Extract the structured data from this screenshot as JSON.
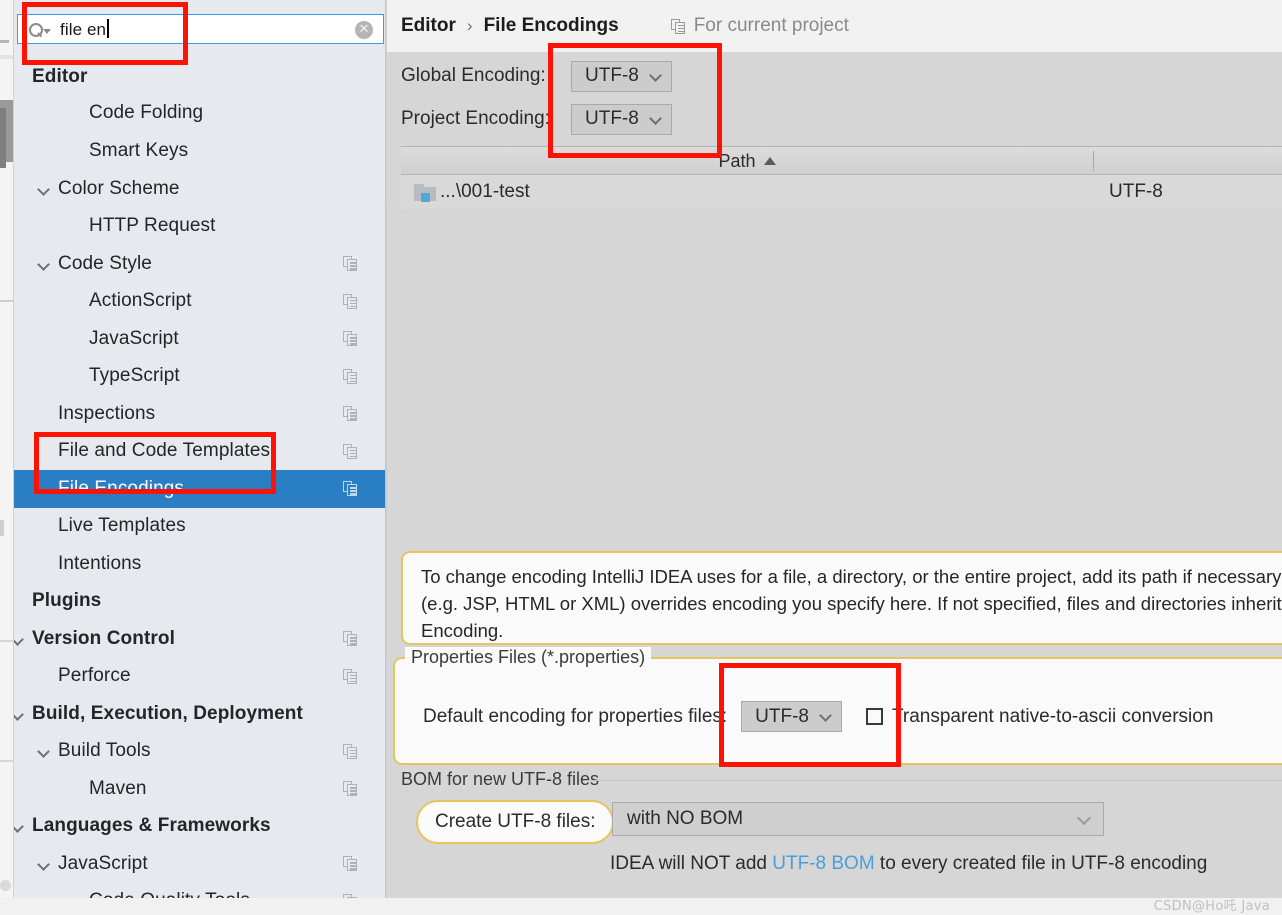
{
  "search": {
    "value": "file en",
    "icon": "search-icon",
    "clear_icon": "clear-circle-icon"
  },
  "sidebar": {
    "items": [
      {
        "label": "Editor",
        "depth": 0,
        "bold": true,
        "expandable": false,
        "copy": false,
        "selected": false,
        "clipped": false
      },
      {
        "label": "Code Folding",
        "depth": 2,
        "bold": false,
        "expandable": false,
        "copy": false,
        "selected": false,
        "clipped": true
      },
      {
        "label": "Smart Keys",
        "depth": 2,
        "bold": false,
        "expandable": false,
        "copy": false,
        "selected": false,
        "clipped": false
      },
      {
        "label": "Color Scheme",
        "depth": 1,
        "bold": false,
        "expandable": true,
        "copy": false,
        "selected": false,
        "clipped": false
      },
      {
        "label": "HTTP Request",
        "depth": 2,
        "bold": false,
        "expandable": false,
        "copy": false,
        "selected": false,
        "clipped": false
      },
      {
        "label": "Code Style",
        "depth": 1,
        "bold": false,
        "expandable": true,
        "copy": true,
        "selected": false,
        "clipped": false
      },
      {
        "label": "ActionScript",
        "depth": 2,
        "bold": false,
        "expandable": false,
        "copy": true,
        "selected": false,
        "clipped": false
      },
      {
        "label": "JavaScript",
        "depth": 2,
        "bold": false,
        "expandable": false,
        "copy": true,
        "selected": false,
        "clipped": false
      },
      {
        "label": "TypeScript",
        "depth": 2,
        "bold": false,
        "expandable": false,
        "copy": true,
        "selected": false,
        "clipped": false
      },
      {
        "label": "Inspections",
        "depth": 1,
        "bold": false,
        "expandable": false,
        "copy": true,
        "selected": false,
        "clipped": false
      },
      {
        "label": "File and Code Templates",
        "depth": 1,
        "bold": false,
        "expandable": false,
        "copy": true,
        "selected": false,
        "clipped": false
      },
      {
        "label": "File Encodings",
        "depth": 1,
        "bold": false,
        "expandable": false,
        "copy": true,
        "selected": true,
        "clipped": false
      },
      {
        "label": "Live Templates",
        "depth": 1,
        "bold": false,
        "expandable": false,
        "copy": false,
        "selected": false,
        "clipped": false
      },
      {
        "label": "Intentions",
        "depth": 1,
        "bold": false,
        "expandable": false,
        "copy": false,
        "selected": false,
        "clipped": false
      },
      {
        "label": "Plugins",
        "depth": 0,
        "bold": true,
        "expandable": false,
        "copy": false,
        "selected": false,
        "clipped": false
      },
      {
        "label": "Version Control",
        "depth": 0,
        "bold": true,
        "expandable": true,
        "copy": true,
        "selected": false,
        "clipped": false
      },
      {
        "label": "Perforce",
        "depth": 1,
        "bold": false,
        "expandable": false,
        "copy": true,
        "selected": false,
        "clipped": false
      },
      {
        "label": "Build, Execution, Deployment",
        "depth": 0,
        "bold": true,
        "expandable": true,
        "copy": false,
        "selected": false,
        "clipped": false
      },
      {
        "label": "Build Tools",
        "depth": 1,
        "bold": false,
        "expandable": true,
        "copy": true,
        "selected": false,
        "clipped": false
      },
      {
        "label": "Maven",
        "depth": 2,
        "bold": false,
        "expandable": false,
        "copy": true,
        "selected": false,
        "clipped": false
      },
      {
        "label": "Languages & Frameworks",
        "depth": 0,
        "bold": true,
        "expandable": true,
        "copy": false,
        "selected": false,
        "clipped": false
      },
      {
        "label": "JavaScript",
        "depth": 1,
        "bold": false,
        "expandable": true,
        "copy": true,
        "selected": false,
        "clipped": false
      },
      {
        "label": "Code Quality Tools",
        "depth": 2,
        "bold": false,
        "expandable": true,
        "copy": true,
        "selected": false,
        "clipped": false
      }
    ]
  },
  "breadcrumb": {
    "parent": "Editor",
    "separator": "›",
    "current": "File Encodings",
    "scope_label": "For current project",
    "scope_icon": "copy-icon"
  },
  "encoding": {
    "global_label": "Global Encoding:",
    "global_value": "UTF-8",
    "project_label": "Project Encoding:",
    "project_value": "UTF-8"
  },
  "table": {
    "columns": [
      "Path",
      ""
    ],
    "sort_column": "Path",
    "sort_direction": "ascending",
    "rows": [
      {
        "path": "...\\001-test",
        "encoding": "UTF-8",
        "icon": "folder-icon"
      }
    ]
  },
  "info": {
    "lines": [
      "To change encoding IntelliJ IDEA uses for a file, a directory, or the entire project, add its path if necessary",
      "(e.g. JSP, HTML or XML) overrides encoding you specify here. If not specified, files and directories inherit",
      "Encoding."
    ]
  },
  "properties_files": {
    "group_title": "Properties Files (*.properties)",
    "default_encoding_label": "Default encoding for properties files:",
    "default_encoding_value": "UTF-8",
    "transparent_checkbox_label": "Transparent native-to-ascii conversion",
    "transparent_checked": false
  },
  "bom": {
    "group_title": "BOM for new UTF-8 files",
    "create_label": "Create UTF-8 files:",
    "create_value": "with NO BOM",
    "note_prefix": "IDEA will NOT add ",
    "note_link": "UTF-8 BOM",
    "note_suffix": " to every created file in UTF-8 encoding"
  },
  "watermark": {
    "text": "CSDN@Ho吒 Java"
  },
  "colors": {
    "accent_selection": "#2a7fc4",
    "annotation_red": "#fb1405",
    "highlight_yellow": "#e6c55c",
    "link_blue": "#4a9fd8",
    "sidebar_bg": "#e6eaee",
    "panel_bg": "#d6d6d6"
  }
}
